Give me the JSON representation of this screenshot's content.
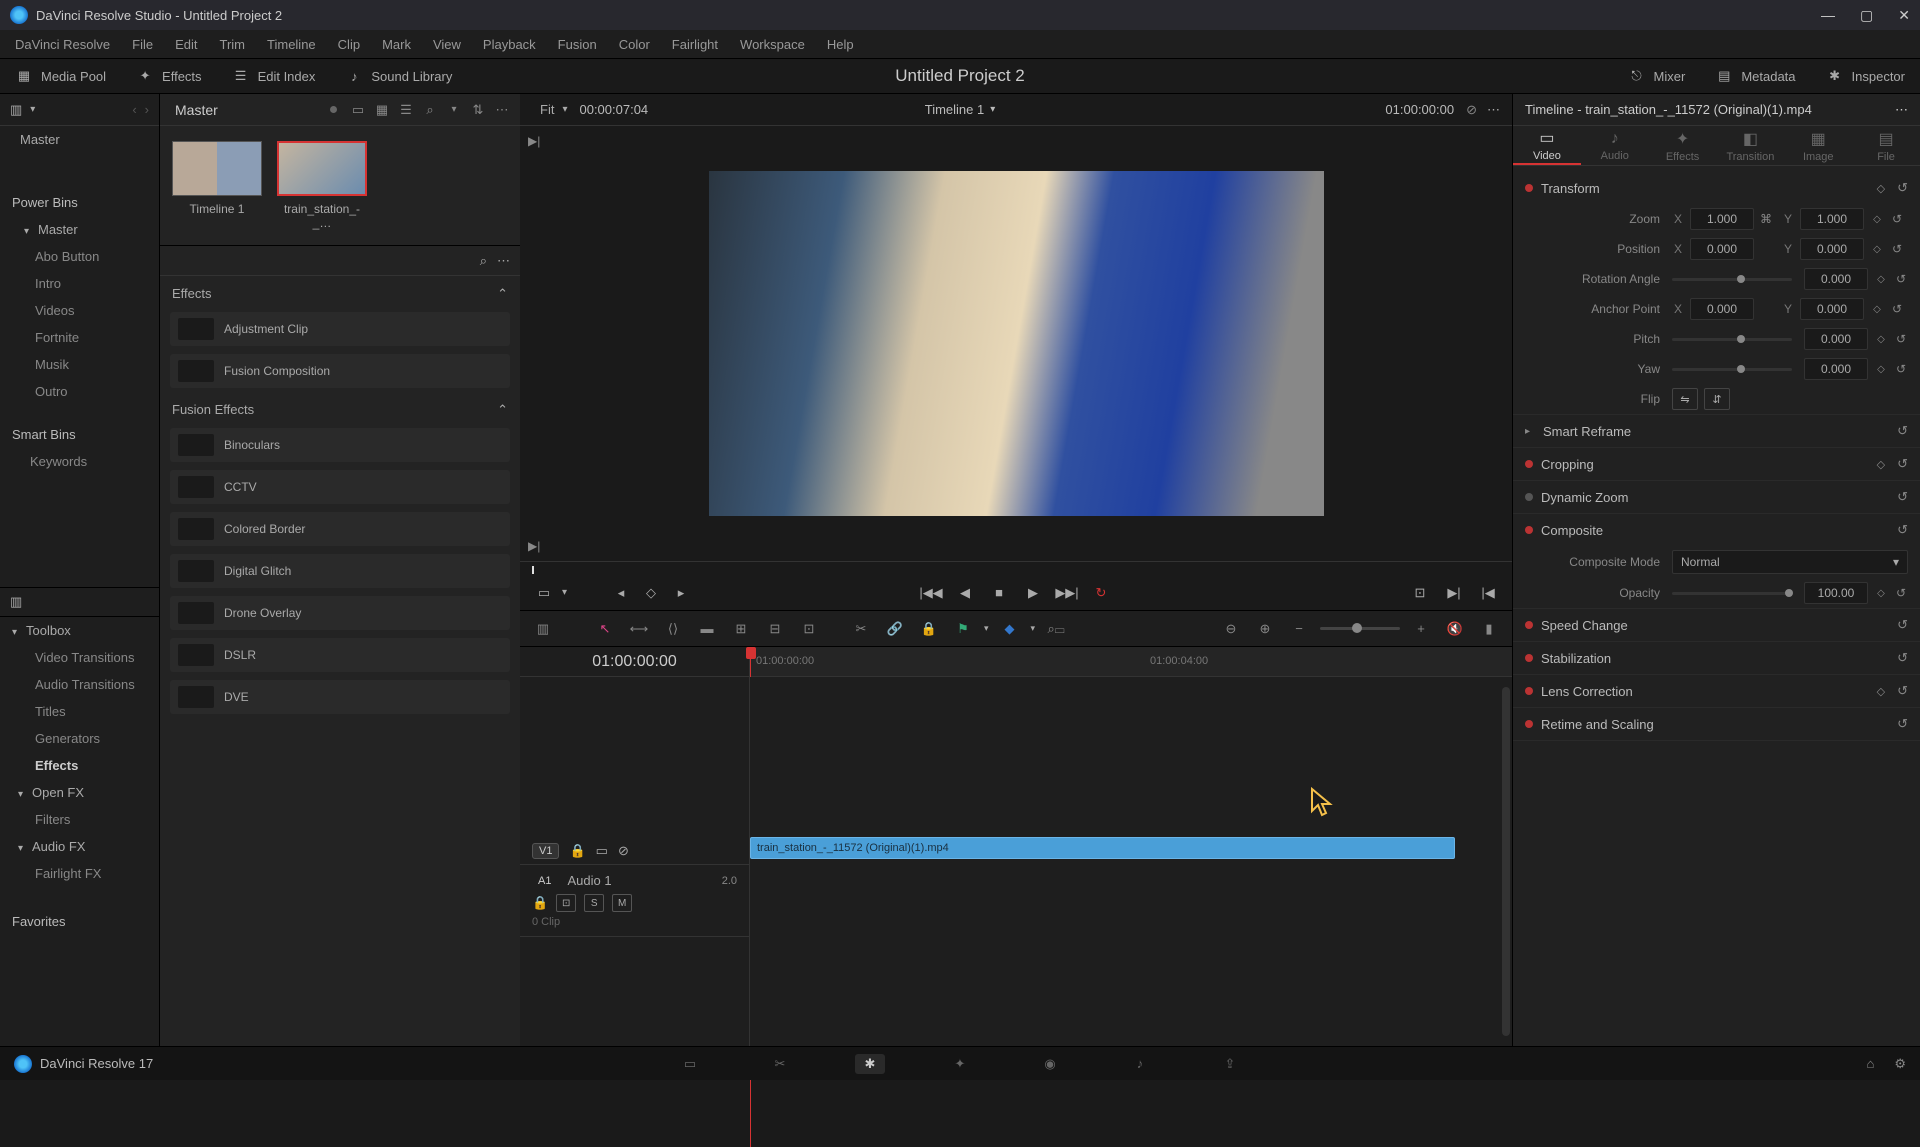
{
  "window": {
    "title": "DaVinci Resolve Studio - Untitled Project 2"
  },
  "menu": [
    "DaVinci Resolve",
    "File",
    "Edit",
    "Trim",
    "Timeline",
    "Clip",
    "Mark",
    "View",
    "Playback",
    "Fusion",
    "Color",
    "Fairlight",
    "Workspace",
    "Help"
  ],
  "secondary": {
    "media_pool": "Media Pool",
    "effects": "Effects",
    "edit_index": "Edit Index",
    "sound_library": "Sound Library",
    "mixer": "Mixer",
    "metadata": "Metadata",
    "inspector": "Inspector"
  },
  "project_title": "Untitled Project 2",
  "media_tree": {
    "master": "Master",
    "power_bins": "Power Bins",
    "power_master": "Master",
    "bins": [
      "Abo Button",
      "Intro",
      "Videos",
      "Fortnite",
      "Musik",
      "Outro"
    ],
    "smart_bins": "Smart Bins",
    "keywords": "Keywords"
  },
  "pool": {
    "title": "Master",
    "thumbs": [
      {
        "label": "Timeline 1"
      },
      {
        "label": "train_station_-_…"
      }
    ]
  },
  "toolbox": {
    "root": "Toolbox",
    "items": [
      "Video Transitions",
      "Audio Transitions",
      "Titles",
      "Generators",
      "Effects",
      "Open FX",
      "Filters",
      "Audio FX",
      "Fairlight FX"
    ],
    "favorites": "Favorites"
  },
  "fx_panel": {
    "effects_header": "Effects",
    "effects": [
      "Adjustment Clip",
      "Fusion Composition"
    ],
    "fusion_header": "Fusion Effects",
    "fusion": [
      "Binoculars",
      "CCTV",
      "Colored Border",
      "Digital Glitch",
      "Drone Overlay",
      "DSLR",
      "DVE"
    ]
  },
  "viewer": {
    "fit": "Fit",
    "tc_left": "00:00:07:04",
    "timeline_name": "Timeline 1",
    "tc_right": "01:00:00:00"
  },
  "timeline": {
    "start_tc": "01:00:00:00",
    "ruler_labels": {
      "a": "01:00:00:00",
      "b": "01:00:04:00"
    },
    "v1": "V1",
    "a1": "A1",
    "audio_name": "Audio 1",
    "audio_ch": "2.0",
    "s": "S",
    "m": "M",
    "clip_count": "0 Clip",
    "clip_name": "train_station_-_11572 (Original)(1).mp4"
  },
  "inspector_panel": {
    "title": "Timeline - train_station_-_11572 (Original)(1).mp4",
    "tabs": [
      "Video",
      "Audio",
      "Effects",
      "Transition",
      "Image",
      "File"
    ],
    "transform": {
      "label": "Transform",
      "zoom_label": "Zoom",
      "zoom_x": "1.000",
      "zoom_y": "1.000",
      "position_label": "Position",
      "pos_x": "0.000",
      "pos_y": "0.000",
      "rotation_label": "Rotation Angle",
      "rotation": "0.000",
      "anchor_label": "Anchor Point",
      "anchor_x": "0.000",
      "anchor_y": "0.000",
      "pitch_label": "Pitch",
      "pitch": "0.000",
      "yaw_label": "Yaw",
      "yaw": "0.000",
      "flip_label": "Flip"
    },
    "sections": {
      "smart_reframe": "Smart Reframe",
      "cropping": "Cropping",
      "dynamic_zoom": "Dynamic Zoom",
      "composite": "Composite",
      "composite_mode_label": "Composite Mode",
      "composite_mode_value": "Normal",
      "opacity_label": "Opacity",
      "opacity_value": "100.00",
      "speed_change": "Speed Change",
      "stabilization": "Stabilization",
      "lens_correction": "Lens Correction",
      "retime": "Retime and Scaling"
    }
  },
  "footer": {
    "app_name": "DaVinci Resolve 17"
  },
  "axis": {
    "x": "X",
    "y": "Y"
  }
}
